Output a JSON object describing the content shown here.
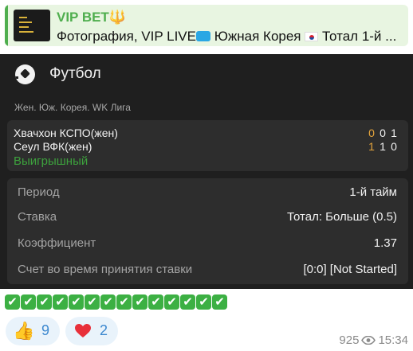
{
  "reply": {
    "sender": "VIP BET",
    "sender_emoji": "🔱",
    "preview_text": "Фотография, VIP LIVE",
    "preview_country": "Южная Корея",
    "preview_tail": "Тотал 1-й ..."
  },
  "bet": {
    "sport": "Футбол",
    "league": "Жен. Юж. Корея. WK Лига",
    "team1": "Хвачхон КСПО(жен)",
    "team2": "Сеул ВФК(жен)",
    "team1_scores": [
      "0",
      "0",
      "1"
    ],
    "team2_scores": [
      "1",
      "1",
      "0"
    ],
    "result": "Выигрышный",
    "rows": [
      {
        "label": "Период",
        "value": "1-й тайм"
      },
      {
        "label": "Ставка",
        "value": "Тотал: Больше (0.5)"
      },
      {
        "label": "Коэффициент",
        "value": "1.37"
      },
      {
        "label": "Счет во время принятия ставки",
        "value": "[0:0] [Not Started]"
      }
    ]
  },
  "checkmarks": [
    "✔",
    "✔",
    "✔",
    "✔",
    "✔",
    "✔",
    "✔",
    "✔",
    "✔",
    "✔",
    "✔",
    "✔",
    "✔",
    "✔"
  ],
  "reactions": [
    {
      "emoji": "👍",
      "count": "9"
    },
    {
      "emoji": "heart-icon",
      "count": "2"
    }
  ],
  "meta": {
    "views": "925",
    "time": "15:34"
  },
  "colors": {
    "accent_green": "#4fae4e",
    "win_green": "#3da13d",
    "score_highlight": "#e5a53c",
    "card_bg": "#1f1f1f",
    "reaction_blue": "#3c88cf"
  }
}
